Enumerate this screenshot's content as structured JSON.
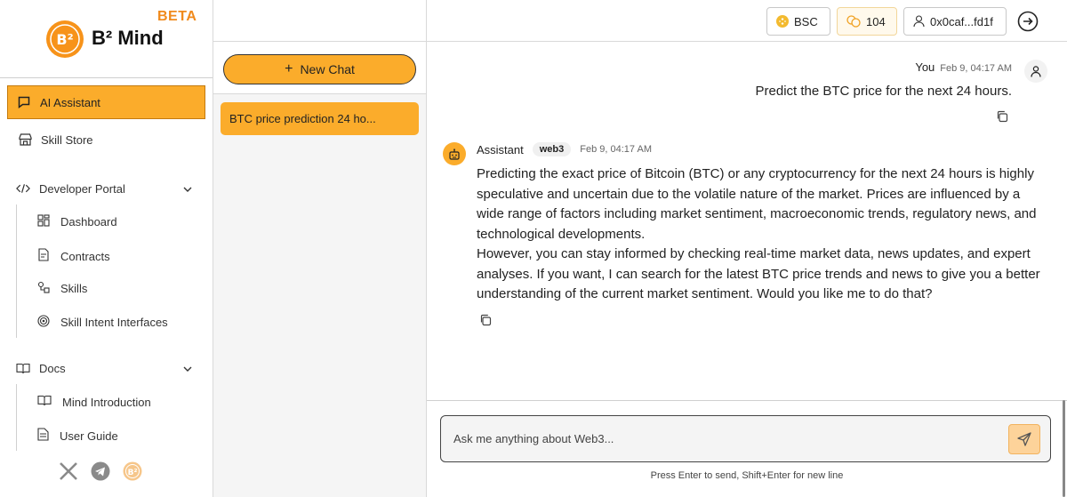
{
  "brand": {
    "beta": "BETA",
    "name": "B² Mind",
    "logo_text": "B²"
  },
  "sidebar": {
    "ai_assistant": "AI Assistant",
    "skill_store": "Skill Store",
    "developer_portal": {
      "label": "Developer Portal",
      "items": [
        "Dashboard",
        "Contracts",
        "Skills",
        "Skill Intent Interfaces"
      ]
    },
    "docs": {
      "label": "Docs",
      "items": [
        "Mind Introduction",
        "User Guide"
      ]
    }
  },
  "chatlist": {
    "new_chat": "New Chat",
    "new_chat_icon": "+",
    "entries": [
      "BTC price prediction 24 ho..."
    ]
  },
  "topbar": {
    "network": "BSC",
    "points": "104",
    "address": "0x0caf...fd1f"
  },
  "conversation": {
    "user": {
      "name": "You",
      "time": "Feb 9, 04:17 AM",
      "message": "Predict the BTC price for the next 24 hours."
    },
    "assistant": {
      "name": "Assistant",
      "tag": "web3",
      "time": "Feb 9, 04:17 AM",
      "paragraph1": "Predicting the exact price of Bitcoin (BTC) or any cryptocurrency for the next 24 hours is highly speculative and uncertain due to the volatile nature of the market. Prices are influenced by a wide range of factors including market sentiment, macroeconomic trends, regulatory news, and technological developments.",
      "paragraph2": "However, you can stay informed by checking real-time market data, news updates, and expert analyses. If you want, I can search for the latest BTC price trends and news to give you a better understanding of the current market sentiment. Would you like me to do that?"
    }
  },
  "composer": {
    "placeholder": "Ask me anything about Web3...",
    "hint": "Press Enter to send, Shift+Enter for new line"
  },
  "colors": {
    "accent": "#fbac2b",
    "beta": "#f08a1c"
  },
  "icons": [
    "chat-bubble-icon",
    "store-icon",
    "code-icon",
    "chevron-down-icon",
    "dashboard-icon",
    "contract-icon",
    "skills-icon",
    "target-icon",
    "book-icon",
    "document-icon",
    "x-logo-icon",
    "telegram-icon",
    "b2-coin-icon",
    "bsc-icon",
    "points-icon",
    "user-icon",
    "logout-icon",
    "copy-icon",
    "robot-icon",
    "send-icon"
  ]
}
